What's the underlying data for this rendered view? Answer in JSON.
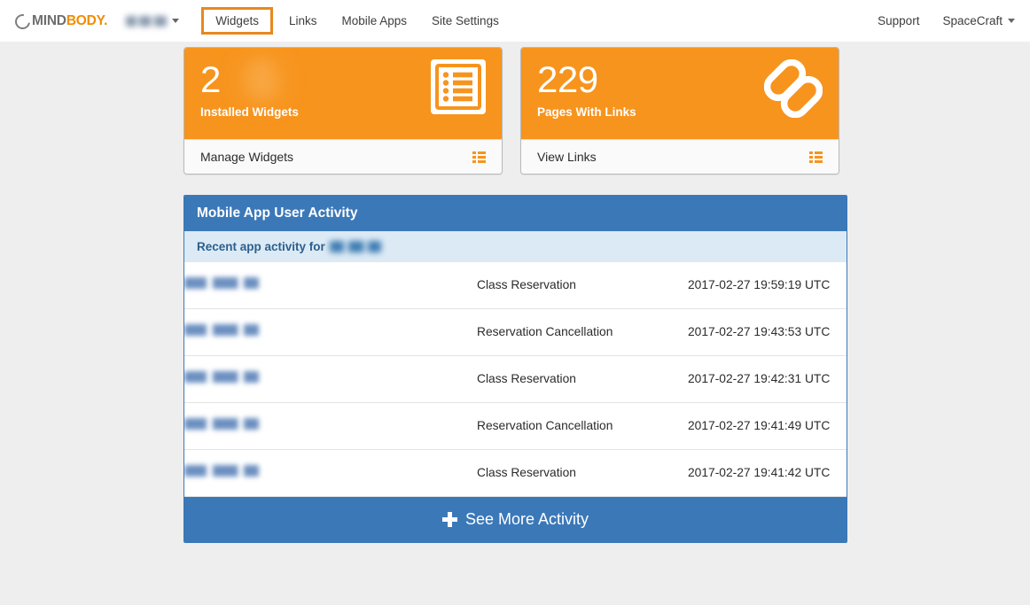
{
  "brand": {
    "logo_mind": "MIND",
    "logo_body": "BODY."
  },
  "header": {
    "studio_name_redacted": "",
    "nav": [
      {
        "label": "Widgets",
        "highlighted": true
      },
      {
        "label": "Links",
        "highlighted": false
      },
      {
        "label": "Mobile Apps",
        "highlighted": false
      },
      {
        "label": "Site Settings",
        "highlighted": false
      }
    ],
    "support_label": "Support",
    "account_label": "SpaceCraft"
  },
  "cards": [
    {
      "number": "2",
      "ghost_number": "6",
      "label": "Installed Widgets",
      "action_label": "Manage Widgets",
      "icon": "list-icon"
    },
    {
      "number": "229",
      "ghost_number": "",
      "label": "Pages With Links",
      "action_label": "View Links",
      "icon": "chain-link-icon"
    }
  ],
  "activity_panel": {
    "title": "Mobile App User Activity",
    "subtitle_prefix": "Recent app activity for",
    "subtitle_studio_redacted": "",
    "rows": [
      {
        "name": "",
        "action": "Class Reservation",
        "timestamp": "2017-02-27 19:59:19 UTC"
      },
      {
        "name": "",
        "action": "Reservation Cancellation",
        "timestamp": "2017-02-27 19:43:53 UTC"
      },
      {
        "name": "",
        "action": "Class Reservation",
        "timestamp": "2017-02-27 19:42:31 UTC"
      },
      {
        "name": "",
        "action": "Reservation Cancellation",
        "timestamp": "2017-02-27 19:41:49 UTC"
      },
      {
        "name": "",
        "action": "Class Reservation",
        "timestamp": "2017-02-27 19:41:42 UTC"
      }
    ],
    "footer_label": "See More Activity"
  },
  "colors": {
    "orange": "#f7941d",
    "orange_highlight": "#e8881c",
    "blue": "#3b78b8",
    "blue_light": "#dceaf5",
    "page_bg": "#eeeeee"
  }
}
